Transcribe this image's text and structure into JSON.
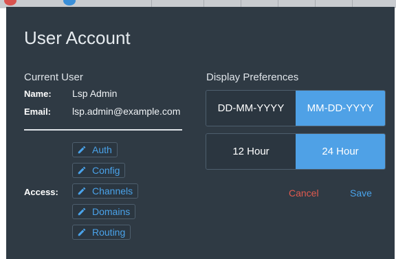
{
  "dialog": {
    "title": "User Account"
  },
  "current_user": {
    "section_label": "Current User",
    "name_label": "Name:",
    "name_value": "Lsp Admin",
    "email_label": "Email:",
    "email_value": "lsp.admin@example.com",
    "access_label": "Access:",
    "access_items": [
      {
        "label": "Auth",
        "icon": "pencil-icon"
      },
      {
        "label": "Config",
        "icon": "pencil-icon"
      },
      {
        "label": "Channels",
        "icon": "pencil-icon"
      },
      {
        "label": "Domains",
        "icon": "pencil-icon"
      },
      {
        "label": "Routing",
        "icon": "pencil-icon"
      }
    ]
  },
  "display_preferences": {
    "section_label": "Display Preferences",
    "date_format": {
      "options": [
        "DD-MM-YYYY",
        "MM-DD-YYYY"
      ],
      "selected": "MM-DD-YYYY"
    },
    "time_format": {
      "options": [
        "12 Hour",
        "24 Hour"
      ],
      "selected": "24 Hour"
    }
  },
  "actions": {
    "cancel_label": "Cancel",
    "save_label": "Save"
  },
  "colors": {
    "dialog_bg": "#2f3a44",
    "accent": "#4fa1e6",
    "link": "#4aa3ea",
    "cancel": "#e05a4f"
  }
}
